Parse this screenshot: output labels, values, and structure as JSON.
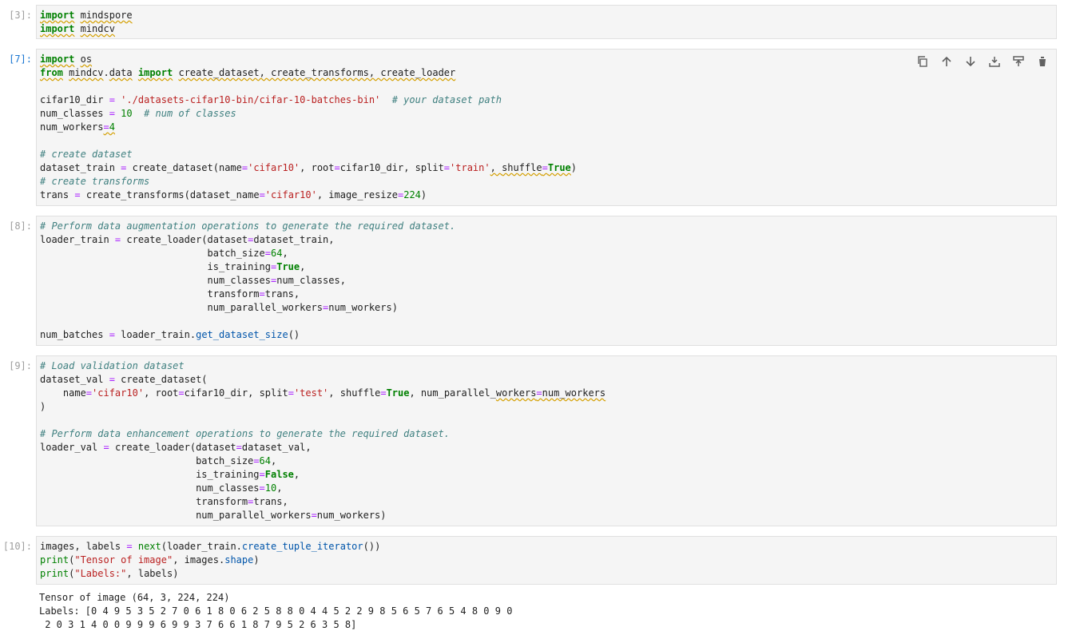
{
  "cells": [
    {
      "prompt": "[3]:",
      "lines": [
        [
          {
            "t": "import",
            "c": "kw sq"
          },
          {
            "t": " "
          },
          {
            "t": "mindspore",
            "c": "sq"
          }
        ],
        [
          {
            "t": "import",
            "c": "kw sq"
          },
          {
            "t": " "
          },
          {
            "t": "mindcv",
            "c": "sq"
          }
        ]
      ]
    },
    {
      "prompt": "[7]:",
      "active": true,
      "toolbar": [
        "copy-icon",
        "move-up-icon",
        "move-down-icon",
        "insert-above-icon",
        "insert-below-icon",
        "delete-icon"
      ],
      "lines": [
        [
          {
            "t": "import",
            "c": "kw sq"
          },
          {
            "t": " "
          },
          {
            "t": "os",
            "c": "sq"
          }
        ],
        [
          {
            "t": "from",
            "c": "kw sq"
          },
          {
            "t": " "
          },
          {
            "t": "mindcv",
            "c": "sq"
          },
          {
            "t": "."
          },
          {
            "t": "data",
            "c": "sq"
          },
          {
            "t": " "
          },
          {
            "t": "import",
            "c": "kw sq"
          },
          {
            "t": " "
          },
          {
            "t": "create_dataset, create_transforms, create_loader",
            "c": "sq"
          }
        ],
        [
          {
            "t": ""
          }
        ],
        [
          {
            "t": "cifar10_dir "
          },
          {
            "t": "=",
            "c": "op"
          },
          {
            "t": " "
          },
          {
            "t": "'./datasets-cifar10-bin/cifar-10-batches-bin'",
            "c": "st"
          },
          {
            "t": "  "
          },
          {
            "t": "# your dataset path",
            "c": "cm"
          }
        ],
        [
          {
            "t": "num_classes "
          },
          {
            "t": "=",
            "c": "op"
          },
          {
            "t": " "
          },
          {
            "t": "10",
            "c": "nu"
          },
          {
            "t": "  "
          },
          {
            "t": "# num of classes",
            "c": "cm"
          }
        ],
        [
          {
            "t": "num_workers"
          },
          {
            "t": "=",
            "c": "op sq"
          },
          {
            "t": "4",
            "c": "nu sq"
          }
        ],
        [
          {
            "t": ""
          }
        ],
        [
          {
            "t": "# create dataset",
            "c": "cm"
          }
        ],
        [
          {
            "t": "dataset_train "
          },
          {
            "t": "=",
            "c": "op"
          },
          {
            "t": " create_dataset(name"
          },
          {
            "t": "=",
            "c": "op"
          },
          {
            "t": "'cifar10'",
            "c": "st"
          },
          {
            "t": ", root"
          },
          {
            "t": "=",
            "c": "op"
          },
          {
            "t": "cifar10_dir, split"
          },
          {
            "t": "=",
            "c": "op"
          },
          {
            "t": "'train'",
            "c": "st"
          },
          {
            "t": ", ",
            "c": "sq"
          },
          {
            "t": "shuffle",
            "c": "sq"
          },
          {
            "t": "=",
            "c": "op sq"
          },
          {
            "t": "True",
            "c": "kw sq"
          },
          {
            "t": ")"
          }
        ],
        [
          {
            "t": "# create transforms",
            "c": "cm"
          }
        ],
        [
          {
            "t": "trans "
          },
          {
            "t": "=",
            "c": "op"
          },
          {
            "t": " create_transforms(dataset_name"
          },
          {
            "t": "=",
            "c": "op"
          },
          {
            "t": "'cifar10'",
            "c": "st"
          },
          {
            "t": ", image_resize"
          },
          {
            "t": "=",
            "c": "op"
          },
          {
            "t": "224",
            "c": "nu"
          },
          {
            "t": ")"
          }
        ]
      ]
    },
    {
      "prompt": "[8]:",
      "lines": [
        [
          {
            "t": "# Perform data augmentation operations to generate the required dataset.",
            "c": "cm"
          }
        ],
        [
          {
            "t": "loader_train "
          },
          {
            "t": "=",
            "c": "op"
          },
          {
            "t": " create_loader(dataset"
          },
          {
            "t": "=",
            "c": "op"
          },
          {
            "t": "dataset_train,"
          }
        ],
        [
          {
            "t": "                             batch_size"
          },
          {
            "t": "=",
            "c": "op"
          },
          {
            "t": "64",
            "c": "nu"
          },
          {
            "t": ","
          }
        ],
        [
          {
            "t": "                             is_training"
          },
          {
            "t": "=",
            "c": "op"
          },
          {
            "t": "True",
            "c": "kw"
          },
          {
            "t": ","
          }
        ],
        [
          {
            "t": "                             num_classes"
          },
          {
            "t": "=",
            "c": "op"
          },
          {
            "t": "num_classes,"
          }
        ],
        [
          {
            "t": "                             transform"
          },
          {
            "t": "=",
            "c": "op"
          },
          {
            "t": "trans,"
          }
        ],
        [
          {
            "t": "                             num_parallel_workers"
          },
          {
            "t": "=",
            "c": "op"
          },
          {
            "t": "num_workers)"
          }
        ],
        [
          {
            "t": ""
          }
        ],
        [
          {
            "t": "num_batches "
          },
          {
            "t": "=",
            "c": "op"
          },
          {
            "t": " loader_train."
          },
          {
            "t": "get_dataset_size",
            "c": "fn"
          },
          {
            "t": "()"
          }
        ]
      ]
    },
    {
      "prompt": "[9]:",
      "lines": [
        [
          {
            "t": "# Load validation dataset",
            "c": "cm"
          }
        ],
        [
          {
            "t": "dataset_val "
          },
          {
            "t": "=",
            "c": "op"
          },
          {
            "t": " create_dataset("
          }
        ],
        [
          {
            "t": "    name"
          },
          {
            "t": "=",
            "c": "op"
          },
          {
            "t": "'cifar10'",
            "c": "st"
          },
          {
            "t": ", root"
          },
          {
            "t": "=",
            "c": "op"
          },
          {
            "t": "cifar10_dir, split"
          },
          {
            "t": "=",
            "c": "op"
          },
          {
            "t": "'test'",
            "c": "st"
          },
          {
            "t": ", shuffle"
          },
          {
            "t": "=",
            "c": "op"
          },
          {
            "t": "True",
            "c": "kw"
          },
          {
            "t": ", num_parallel_"
          },
          {
            "t": "workers",
            "c": "sq"
          },
          {
            "t": "=",
            "c": "op sq"
          },
          {
            "t": "num_workers",
            "c": "sq"
          }
        ],
        [
          {
            "t": ")"
          }
        ],
        [
          {
            "t": ""
          }
        ],
        [
          {
            "t": "# Perform data enhancement operations to generate the required dataset.",
            "c": "cm"
          }
        ],
        [
          {
            "t": "loader_val "
          },
          {
            "t": "=",
            "c": "op"
          },
          {
            "t": " create_loader(dataset"
          },
          {
            "t": "=",
            "c": "op"
          },
          {
            "t": "dataset_val,"
          }
        ],
        [
          {
            "t": "                           batch_size"
          },
          {
            "t": "=",
            "c": "op"
          },
          {
            "t": "64",
            "c": "nu"
          },
          {
            "t": ","
          }
        ],
        [
          {
            "t": "                           is_training"
          },
          {
            "t": "=",
            "c": "op"
          },
          {
            "t": "False",
            "c": "kw"
          },
          {
            "t": ","
          }
        ],
        [
          {
            "t": "                           num_classes"
          },
          {
            "t": "=",
            "c": "op"
          },
          {
            "t": "10",
            "c": "nu"
          },
          {
            "t": ","
          }
        ],
        [
          {
            "t": "                           transform"
          },
          {
            "t": "=",
            "c": "op"
          },
          {
            "t": "trans,"
          }
        ],
        [
          {
            "t": "                           num_parallel_workers"
          },
          {
            "t": "=",
            "c": "op"
          },
          {
            "t": "num_workers)"
          }
        ]
      ]
    },
    {
      "prompt": "[10]:",
      "lines": [
        [
          {
            "t": "images, labels "
          },
          {
            "t": "=",
            "c": "op"
          },
          {
            "t": " "
          },
          {
            "t": "next",
            "c": "nu"
          },
          {
            "t": "(loader_train."
          },
          {
            "t": "create_tuple_iterator",
            "c": "fn"
          },
          {
            "t": "())"
          }
        ],
        [
          {
            "t": "print",
            "c": "nu"
          },
          {
            "t": "("
          },
          {
            "t": "\"Tensor of image\"",
            "c": "st"
          },
          {
            "t": ", images."
          },
          {
            "t": "shape",
            "c": "fn"
          },
          {
            "t": ")"
          }
        ],
        [
          {
            "t": "print",
            "c": "nu"
          },
          {
            "t": "("
          },
          {
            "t": "\"Labels:\"",
            "c": "st"
          },
          {
            "t": ", labels)"
          }
        ]
      ],
      "output": [
        "Tensor of image (64, 3, 224, 224)",
        "Labels: [0 4 9 5 3 5 2 7 0 6 1 8 0 6 2 5 8 8 0 4 4 5 2 2 9 8 5 6 5 7 6 5 4 8 0 9 0",
        " 2 0 3 1 4 0 0 9 9 9 6 9 9 3 7 6 6 1 8 7 9 5 2 6 3 5 8]"
      ]
    }
  ]
}
